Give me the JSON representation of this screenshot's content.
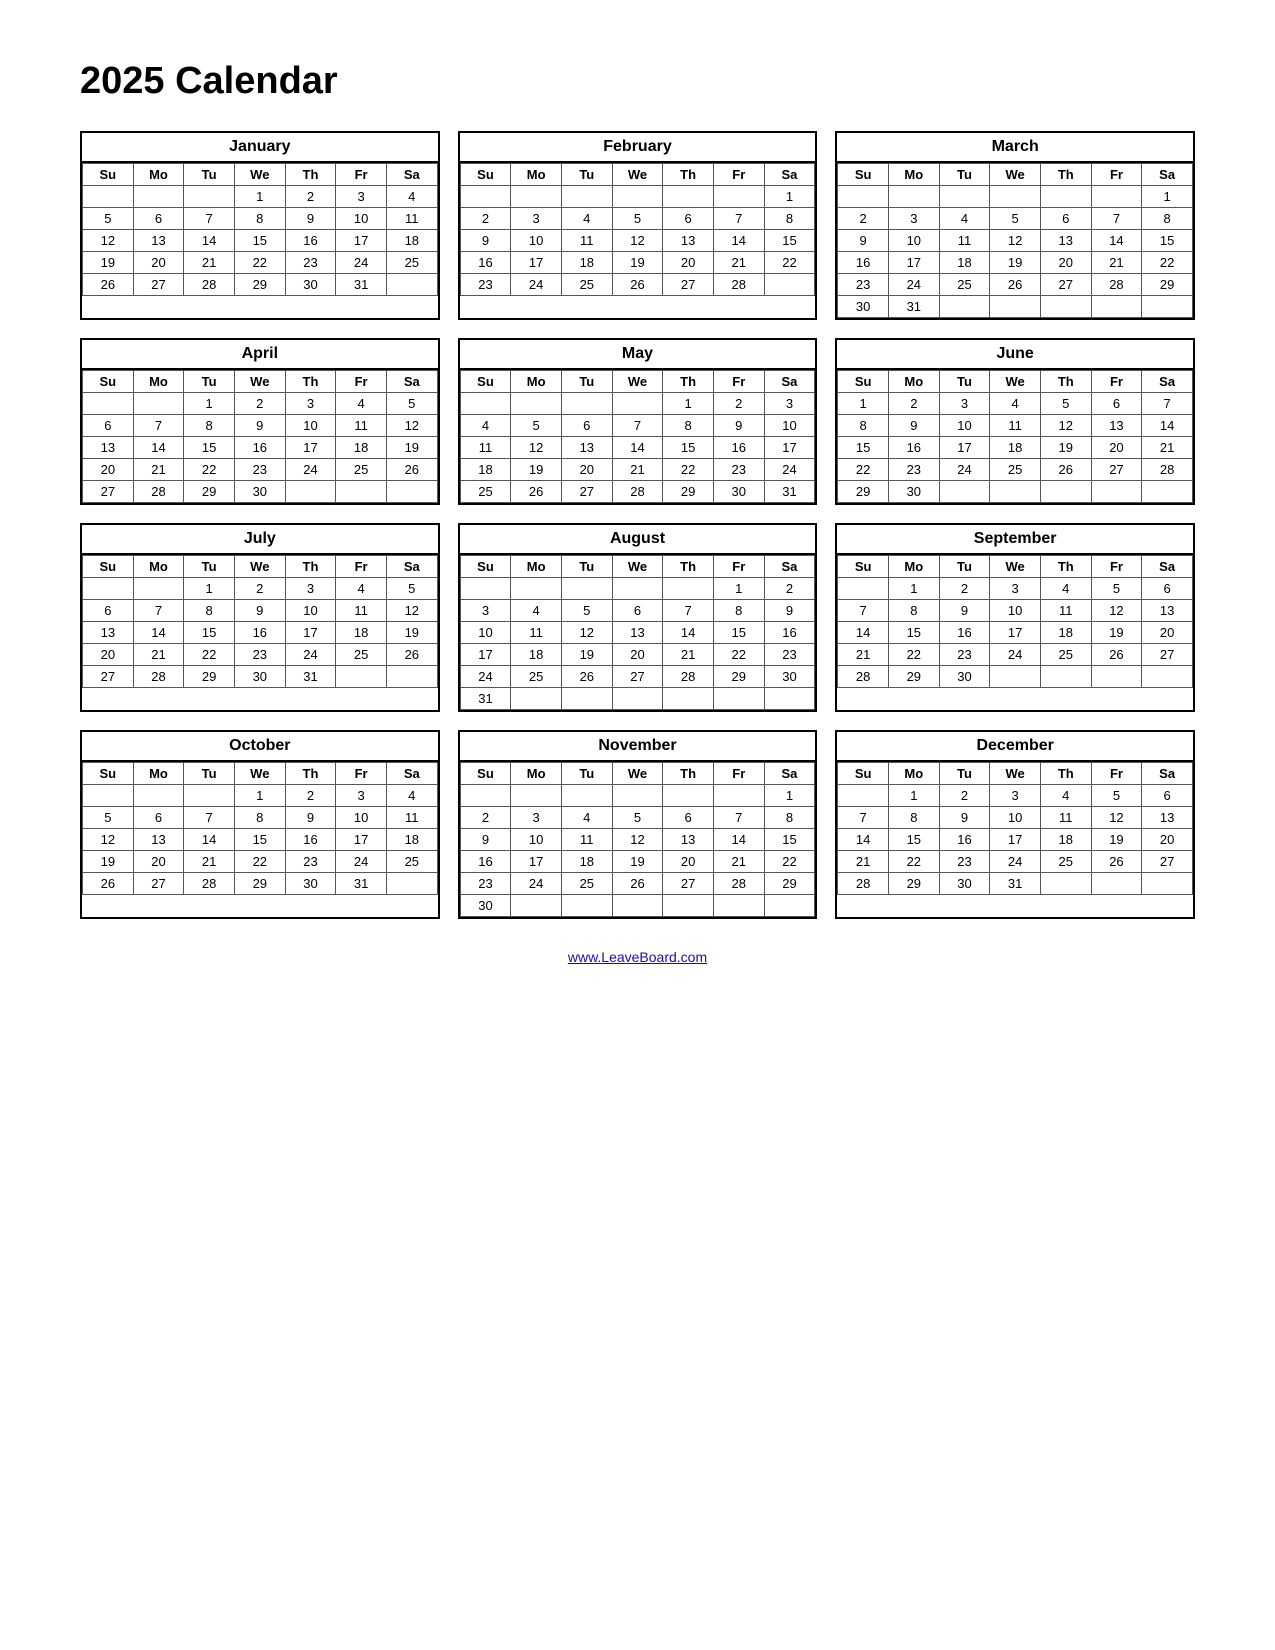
{
  "title": "2025 Calendar",
  "footer": "www.LeaveBoard.com",
  "days_header": [
    "Su",
    "Mo",
    "Tu",
    "We",
    "Th",
    "Fr",
    "Sa"
  ],
  "months": [
    {
      "name": "January",
      "weeks": [
        [
          "",
          "",
          "",
          "1",
          "2",
          "3",
          "4"
        ],
        [
          "5",
          "6",
          "7",
          "8",
          "9",
          "10",
          "11"
        ],
        [
          "12",
          "13",
          "14",
          "15",
          "16",
          "17",
          "18"
        ],
        [
          "19",
          "20",
          "21",
          "22",
          "23",
          "24",
          "25"
        ],
        [
          "26",
          "27",
          "28",
          "29",
          "30",
          "31",
          ""
        ]
      ]
    },
    {
      "name": "February",
      "weeks": [
        [
          "",
          "",
          "",
          "",
          "",
          "",
          "1"
        ],
        [
          "2",
          "3",
          "4",
          "5",
          "6",
          "7",
          "8"
        ],
        [
          "9",
          "10",
          "11",
          "12",
          "13",
          "14",
          "15"
        ],
        [
          "16",
          "17",
          "18",
          "19",
          "20",
          "21",
          "22"
        ],
        [
          "23",
          "24",
          "25",
          "26",
          "27",
          "28",
          ""
        ]
      ]
    },
    {
      "name": "March",
      "weeks": [
        [
          "",
          "",
          "",
          "",
          "",
          "",
          "1"
        ],
        [
          "2",
          "3",
          "4",
          "5",
          "6",
          "7",
          "8"
        ],
        [
          "9",
          "10",
          "11",
          "12",
          "13",
          "14",
          "15"
        ],
        [
          "16",
          "17",
          "18",
          "19",
          "20",
          "21",
          "22"
        ],
        [
          "23",
          "24",
          "25",
          "26",
          "27",
          "28",
          "29"
        ],
        [
          "30",
          "31",
          "",
          "",
          "",
          "",
          ""
        ]
      ]
    },
    {
      "name": "April",
      "weeks": [
        [
          "",
          "",
          "1",
          "2",
          "3",
          "4",
          "5"
        ],
        [
          "6",
          "7",
          "8",
          "9",
          "10",
          "11",
          "12"
        ],
        [
          "13",
          "14",
          "15",
          "16",
          "17",
          "18",
          "19"
        ],
        [
          "20",
          "21",
          "22",
          "23",
          "24",
          "25",
          "26"
        ],
        [
          "27",
          "28",
          "29",
          "30",
          "",
          "",
          ""
        ]
      ]
    },
    {
      "name": "May",
      "weeks": [
        [
          "",
          "",
          "",
          "",
          "1",
          "2",
          "3"
        ],
        [
          "4",
          "5",
          "6",
          "7",
          "8",
          "9",
          "10"
        ],
        [
          "11",
          "12",
          "13",
          "14",
          "15",
          "16",
          "17"
        ],
        [
          "18",
          "19",
          "20",
          "21",
          "22",
          "23",
          "24"
        ],
        [
          "25",
          "26",
          "27",
          "28",
          "29",
          "30",
          "31"
        ]
      ]
    },
    {
      "name": "June",
      "weeks": [
        [
          "1",
          "2",
          "3",
          "4",
          "5",
          "6",
          "7"
        ],
        [
          "8",
          "9",
          "10",
          "11",
          "12",
          "13",
          "14"
        ],
        [
          "15",
          "16",
          "17",
          "18",
          "19",
          "20",
          "21"
        ],
        [
          "22",
          "23",
          "24",
          "25",
          "26",
          "27",
          "28"
        ],
        [
          "29",
          "30",
          "",
          "",
          "",
          "",
          ""
        ]
      ]
    },
    {
      "name": "July",
      "weeks": [
        [
          "",
          "",
          "1",
          "2",
          "3",
          "4",
          "5"
        ],
        [
          "6",
          "7",
          "8",
          "9",
          "10",
          "11",
          "12"
        ],
        [
          "13",
          "14",
          "15",
          "16",
          "17",
          "18",
          "19"
        ],
        [
          "20",
          "21",
          "22",
          "23",
          "24",
          "25",
          "26"
        ],
        [
          "27",
          "28",
          "29",
          "30",
          "31",
          "",
          ""
        ]
      ]
    },
    {
      "name": "August",
      "weeks": [
        [
          "",
          "",
          "",
          "",
          "",
          "1",
          "2"
        ],
        [
          "3",
          "4",
          "5",
          "6",
          "7",
          "8",
          "9"
        ],
        [
          "10",
          "11",
          "12",
          "13",
          "14",
          "15",
          "16"
        ],
        [
          "17",
          "18",
          "19",
          "20",
          "21",
          "22",
          "23"
        ],
        [
          "24",
          "25",
          "26",
          "27",
          "28",
          "29",
          "30"
        ],
        [
          "31",
          "",
          "",
          "",
          "",
          "",
          ""
        ]
      ]
    },
    {
      "name": "September",
      "weeks": [
        [
          "",
          "1",
          "2",
          "3",
          "4",
          "5",
          "6"
        ],
        [
          "7",
          "8",
          "9",
          "10",
          "11",
          "12",
          "13"
        ],
        [
          "14",
          "15",
          "16",
          "17",
          "18",
          "19",
          "20"
        ],
        [
          "21",
          "22",
          "23",
          "24",
          "25",
          "26",
          "27"
        ],
        [
          "28",
          "29",
          "30",
          "",
          "",
          "",
          ""
        ]
      ]
    },
    {
      "name": "October",
      "weeks": [
        [
          "",
          "",
          "",
          "1",
          "2",
          "3",
          "4"
        ],
        [
          "5",
          "6",
          "7",
          "8",
          "9",
          "10",
          "11"
        ],
        [
          "12",
          "13",
          "14",
          "15",
          "16",
          "17",
          "18"
        ],
        [
          "19",
          "20",
          "21",
          "22",
          "23",
          "24",
          "25"
        ],
        [
          "26",
          "27",
          "28",
          "29",
          "30",
          "31",
          ""
        ]
      ]
    },
    {
      "name": "November",
      "weeks": [
        [
          "",
          "",
          "",
          "",
          "",
          "",
          "1"
        ],
        [
          "2",
          "3",
          "4",
          "5",
          "6",
          "7",
          "8"
        ],
        [
          "9",
          "10",
          "11",
          "12",
          "13",
          "14",
          "15"
        ],
        [
          "16",
          "17",
          "18",
          "19",
          "20",
          "21",
          "22"
        ],
        [
          "23",
          "24",
          "25",
          "26",
          "27",
          "28",
          "29"
        ],
        [
          "30",
          "",
          "",
          "",
          "",
          "",
          ""
        ]
      ]
    },
    {
      "name": "December",
      "weeks": [
        [
          "",
          "1",
          "2",
          "3",
          "4",
          "5",
          "6"
        ],
        [
          "7",
          "8",
          "9",
          "10",
          "11",
          "12",
          "13"
        ],
        [
          "14",
          "15",
          "16",
          "17",
          "18",
          "19",
          "20"
        ],
        [
          "21",
          "22",
          "23",
          "24",
          "25",
          "26",
          "27"
        ],
        [
          "28",
          "29",
          "30",
          "31",
          "",
          "",
          ""
        ]
      ]
    }
  ]
}
